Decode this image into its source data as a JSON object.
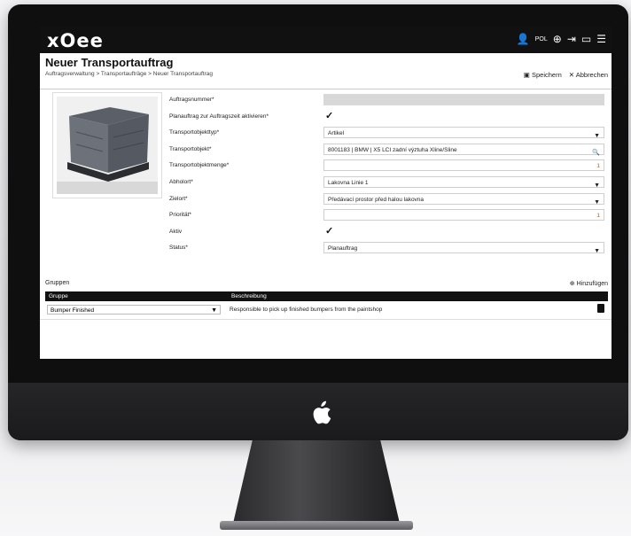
{
  "app": {
    "logo": "xOee",
    "lang": "POL"
  },
  "header": {
    "title": "Neuer Transportauftrag",
    "breadcrumb": "Auftragsverwaltung > Transportaufträge > Neuer Transportauftrag",
    "save_label": "Speichern",
    "cancel_label": "Abbrechen"
  },
  "form": {
    "rows": [
      {
        "label": "Auftragsnummer*",
        "value": ""
      },
      {
        "label": "Planauftrag zur Auftragszeit aktivieren*",
        "value": "✓"
      },
      {
        "label": "Transportobjekttyp*",
        "value": "Artikel"
      },
      {
        "label": "Transportobjekt*",
        "value": "8001183 | BMW | X5 LCI zadní výztuha Xline/Sline"
      },
      {
        "label": "Transportobjektmenge*",
        "value": "1"
      },
      {
        "label": "Abholort*",
        "value": "Lakovna Linie 1"
      },
      {
        "label": "Zielort*",
        "value": "Předávací prostor před halou lakovna"
      },
      {
        "label": "Priorität*",
        "value": "1"
      },
      {
        "label": "Aktiv",
        "value": "✓"
      },
      {
        "label": "Status*",
        "value": "Planauftrag"
      }
    ]
  },
  "groups": {
    "title": "Gruppen",
    "add_label": "Hinzufügen",
    "columns": [
      "Gruppe",
      "Beschreibung"
    ],
    "rows": [
      {
        "group": "Bumper Finished",
        "description": "Responsible to pick up finished bumpers from the paintshop"
      }
    ]
  }
}
